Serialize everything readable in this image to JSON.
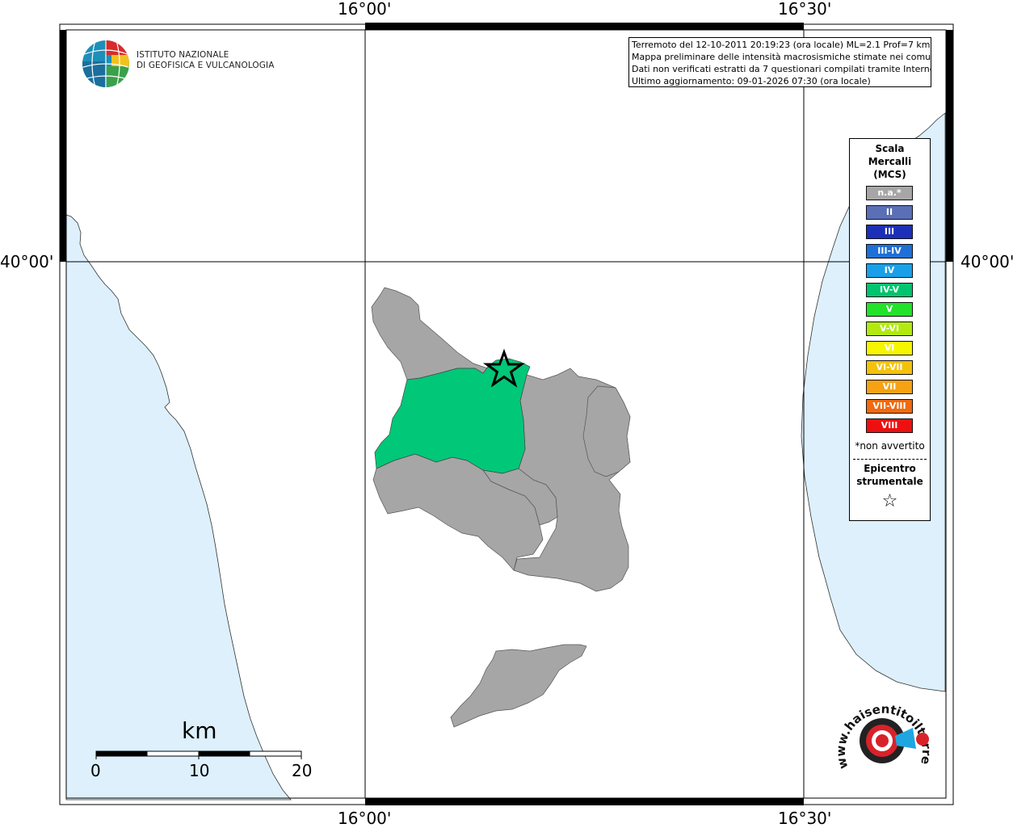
{
  "map": {
    "lon_labels": [
      "16°00'",
      "16°30'"
    ],
    "lat_labels": [
      "40°00'"
    ]
  },
  "info": {
    "lines": [
      "Terremoto del 12-10-2011 20:19:23 (ora locale) ML=2.1 Prof=7 km",
      "Mappa preliminare delle intensità macrosismiche stimate nei comuni",
      "Dati non verificati estratti da 7 questionari compilati tramite Internet.",
      "Ultimo aggiornamento: 09-01-2026 07:30 (ora locale)"
    ]
  },
  "logo": {
    "line1": "ISTITUTO NAZIONALE",
    "line2": "DI GEOFISICA E VULCANOLOGIA"
  },
  "legend": {
    "title_lines": [
      "Scala",
      "Mercalli",
      "(MCS)"
    ],
    "items": [
      {
        "label": "n.a.*",
        "color": "#a6a6a6"
      },
      {
        "label": "II",
        "color": "#5b6fb6"
      },
      {
        "label": "III",
        "color": "#1c2fb8"
      },
      {
        "label": "III-IV",
        "color": "#1e6fd6"
      },
      {
        "label": "IV",
        "color": "#1aa0e8"
      },
      {
        "label": "IV-V",
        "color": "#00c46e"
      },
      {
        "label": "V",
        "color": "#22e22a"
      },
      {
        "label": "V-VI",
        "color": "#b2ea10"
      },
      {
        "label": "VI",
        "color": "#f6f600"
      },
      {
        "label": "VI-VII",
        "color": "#f4c20a"
      },
      {
        "label": "VII",
        "color": "#f6a214"
      },
      {
        "label": "VII-VIII",
        "color": "#f06a10"
      },
      {
        "label": "VIII",
        "color": "#ee1010"
      }
    ],
    "note": "*non avvertito",
    "epicenter_lines": [
      "Epicentro",
      "strumentale"
    ],
    "epicenter_symbol": "☆"
  },
  "scale_bar": {
    "unit": "km",
    "ticks": [
      "0",
      "10",
      "20"
    ]
  },
  "hst_logo": {
    "site": "www.haisentitoilterremoto.it"
  },
  "colors": {
    "sea": "#ddf0fc",
    "land_na": "#a6a6a6",
    "intensity_iv_v": "#00c878"
  }
}
